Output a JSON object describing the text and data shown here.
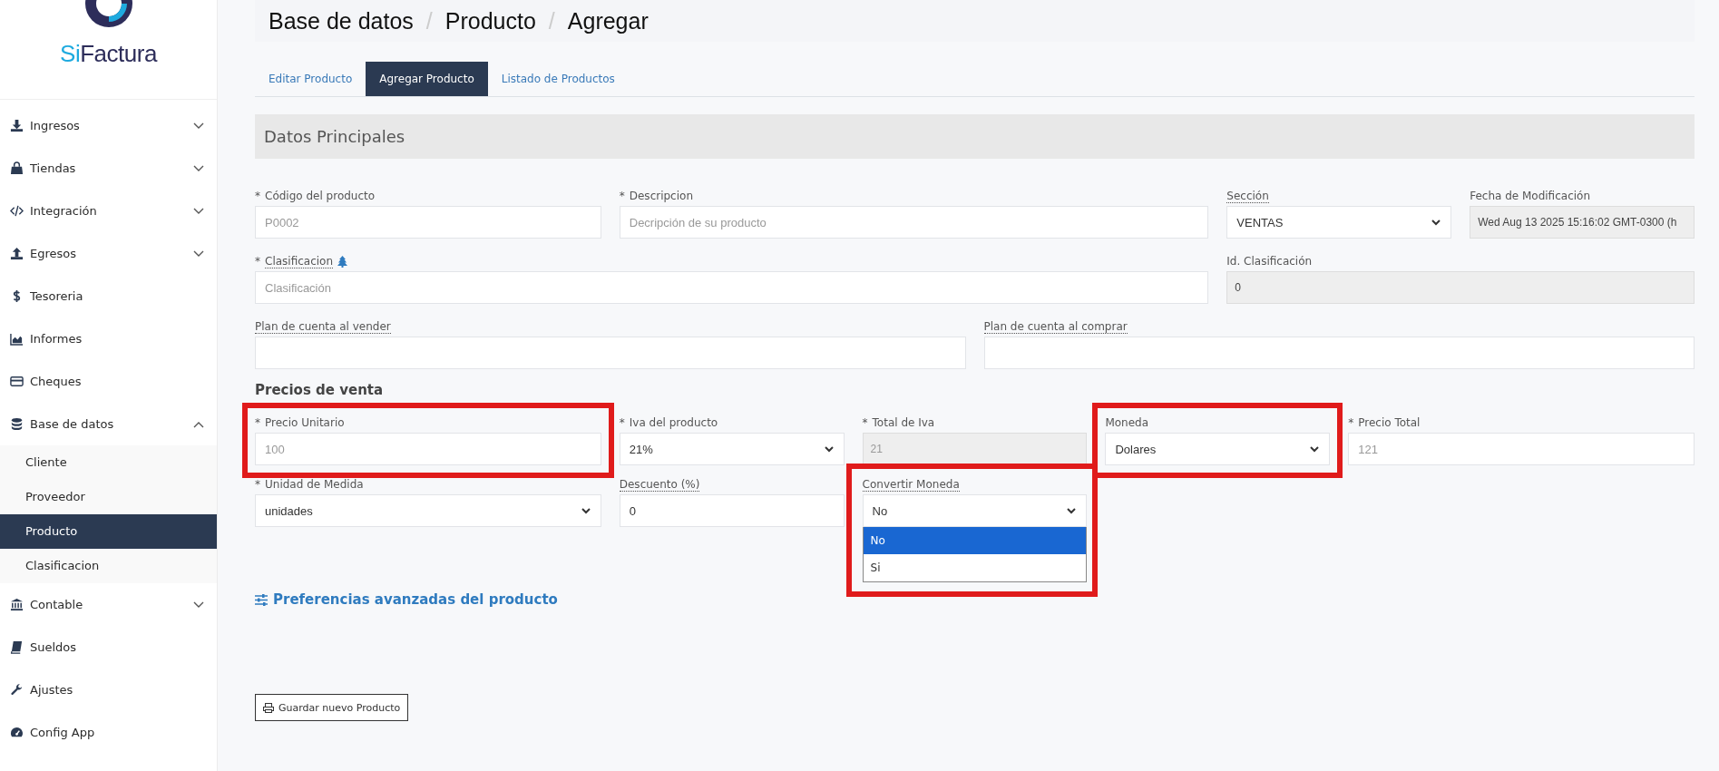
{
  "sidebar": {
    "logo": {
      "accent": "Si",
      "rest": "Factura"
    },
    "items": [
      {
        "label": "Ingresos",
        "expanded": false,
        "selected": false
      },
      {
        "label": "Tiendas",
        "expanded": false,
        "selected": false
      },
      {
        "label": "Integración",
        "expanded": false,
        "selected": false
      },
      {
        "label": "Egresos",
        "expanded": false,
        "selected": false
      },
      {
        "label": "Tesoreria",
        "selected": false
      },
      {
        "label": "Informes",
        "selected": false
      },
      {
        "label": "Cheques",
        "selected": false
      },
      {
        "label": "Base de datos",
        "expanded": true,
        "selected": false,
        "children": [
          {
            "label": "Cliente",
            "selected": false
          },
          {
            "label": "Proveedor",
            "selected": false
          },
          {
            "label": "Producto",
            "selected": true
          },
          {
            "label": "Clasificacion",
            "selected": false
          }
        ]
      },
      {
        "label": "Contable",
        "expanded": false,
        "selected": false
      },
      {
        "label": "Sueldos",
        "selected": false
      },
      {
        "label": "Ajustes",
        "selected": false
      },
      {
        "label": "Config App",
        "selected": false
      }
    ]
  },
  "breadcrumb": {
    "separator": "/",
    "items": [
      "Base de datos",
      "Producto",
      "Agregar"
    ]
  },
  "tabs": [
    {
      "label": "Editar Producto",
      "selected": false
    },
    {
      "label": "Agregar Producto",
      "selected": true
    },
    {
      "label": "Listado de Productos",
      "selected": false
    }
  ],
  "datos": {
    "title": "Datos Principales",
    "fields": [
      {
        "prefix": "*",
        "label": "Código del producto",
        "hint": false,
        "kind": "text",
        "placeholder": "P0002",
        "highlighted": false
      },
      {
        "prefix": "*",
        "label": "Descripcion",
        "hint": false,
        "kind": "text",
        "placeholder": "Decripción de su producto",
        "highlighted": false
      },
      {
        "label": "Sección",
        "hint": true,
        "kind": "select",
        "value": "VENTAS",
        "highlighted": false
      },
      {
        "label": "Fecha de Modificación",
        "hint": false,
        "kind": "readonly",
        "value": "Wed Aug 13 2025 15:16:02 GMT-0300 (h",
        "highlighted": false
      },
      {
        "prefix": "*",
        "label": "Clasificacion",
        "hint": true,
        "tree_icon": true,
        "kind": "text",
        "placeholder": "Clasificación",
        "highlighted": false
      },
      {
        "label": "Id. Clasificación",
        "hint": false,
        "kind": "readonly",
        "value": "0",
        "highlighted": false
      },
      {
        "label": "Plan de cuenta al vender",
        "hint": true,
        "kind": "text",
        "highlighted": false
      },
      {
        "label": "Plan de cuenta al comprar",
        "hint": true,
        "kind": "text",
        "highlighted": false
      }
    ]
  },
  "precios": {
    "title": "Precios de venta",
    "fields": [
      {
        "prefix": "*",
        "label": "Precio Unitario",
        "hint": false,
        "kind": "text",
        "placeholder": "100",
        "highlighted": true
      },
      {
        "prefix": "*",
        "label": "Iva del producto",
        "hint": false,
        "kind": "select",
        "value": "21%",
        "highlighted": false
      },
      {
        "prefix": "*",
        "label": "Total de Iva",
        "hint": false,
        "kind": "readonly",
        "placeholder": "21",
        "highlighted": false
      },
      {
        "label": "Moneda",
        "hint": false,
        "kind": "select",
        "value": "Dolares",
        "highlighted": true
      },
      {
        "prefix": "*",
        "label": "Precio Total",
        "hint": false,
        "kind": "text",
        "placeholder": "121",
        "highlighted": false
      },
      {
        "prefix": "*",
        "label": "Unidad de Medida",
        "hint": false,
        "kind": "select",
        "value": "unidades",
        "highlighted": false
      },
      {
        "label": "Descuento (%)",
        "hint": true,
        "kind": "text",
        "value": "0",
        "highlighted": false
      },
      {
        "label": "Convertir Moneda",
        "hint": true,
        "kind": "select",
        "value": "No",
        "highlighted": true,
        "options": [
          {
            "label": "No",
            "selected": true
          },
          {
            "label": "Si",
            "selected": false
          }
        ]
      }
    ]
  },
  "advanced_link": "Preferencias avanzadas del producto",
  "save_button": "Guardar nuevo Producto"
}
